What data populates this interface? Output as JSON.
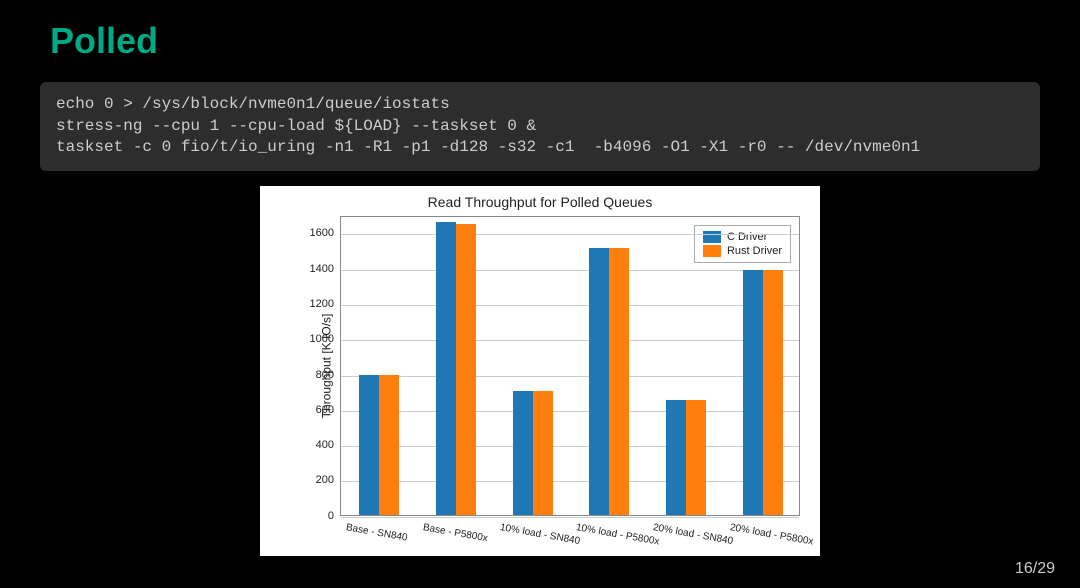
{
  "slide": {
    "title": "Polled",
    "code": "echo 0 > /sys/block/nvme0n1/queue/iostats\nstress-ng --cpu 1 --cpu-load ${LOAD} --taskset 0 &\ntaskset -c 0 fio/t/io_uring -n1 -R1 -p1 -d128 -s32 -c1  -b4096 -O1 -X1 -r0 -- /dev/nvme0n1",
    "page_number": "16/29"
  },
  "chart_data": {
    "type": "bar",
    "title": "Read Throughput for Polled Queues",
    "ylabel": "Throughput [K IO/s]",
    "xlabel": "",
    "ylim": [
      0,
      1700
    ],
    "yticks": [
      0,
      200,
      400,
      600,
      800,
      1000,
      1200,
      1400,
      1600
    ],
    "categories": [
      "Base - SN840",
      "Base - P5800x",
      "10% load - SN840",
      "10% load - P5800x",
      "20% load - SN840",
      "20% load - P5800x"
    ],
    "series": [
      {
        "name": "C Driver",
        "color": "#1f77b4",
        "values": [
          790,
          1660,
          700,
          1510,
          650,
          1390
        ]
      },
      {
        "name": "Rust Driver",
        "color": "#ff7f0e",
        "values": [
          790,
          1650,
          700,
          1510,
          650,
          1390
        ]
      }
    ]
  }
}
